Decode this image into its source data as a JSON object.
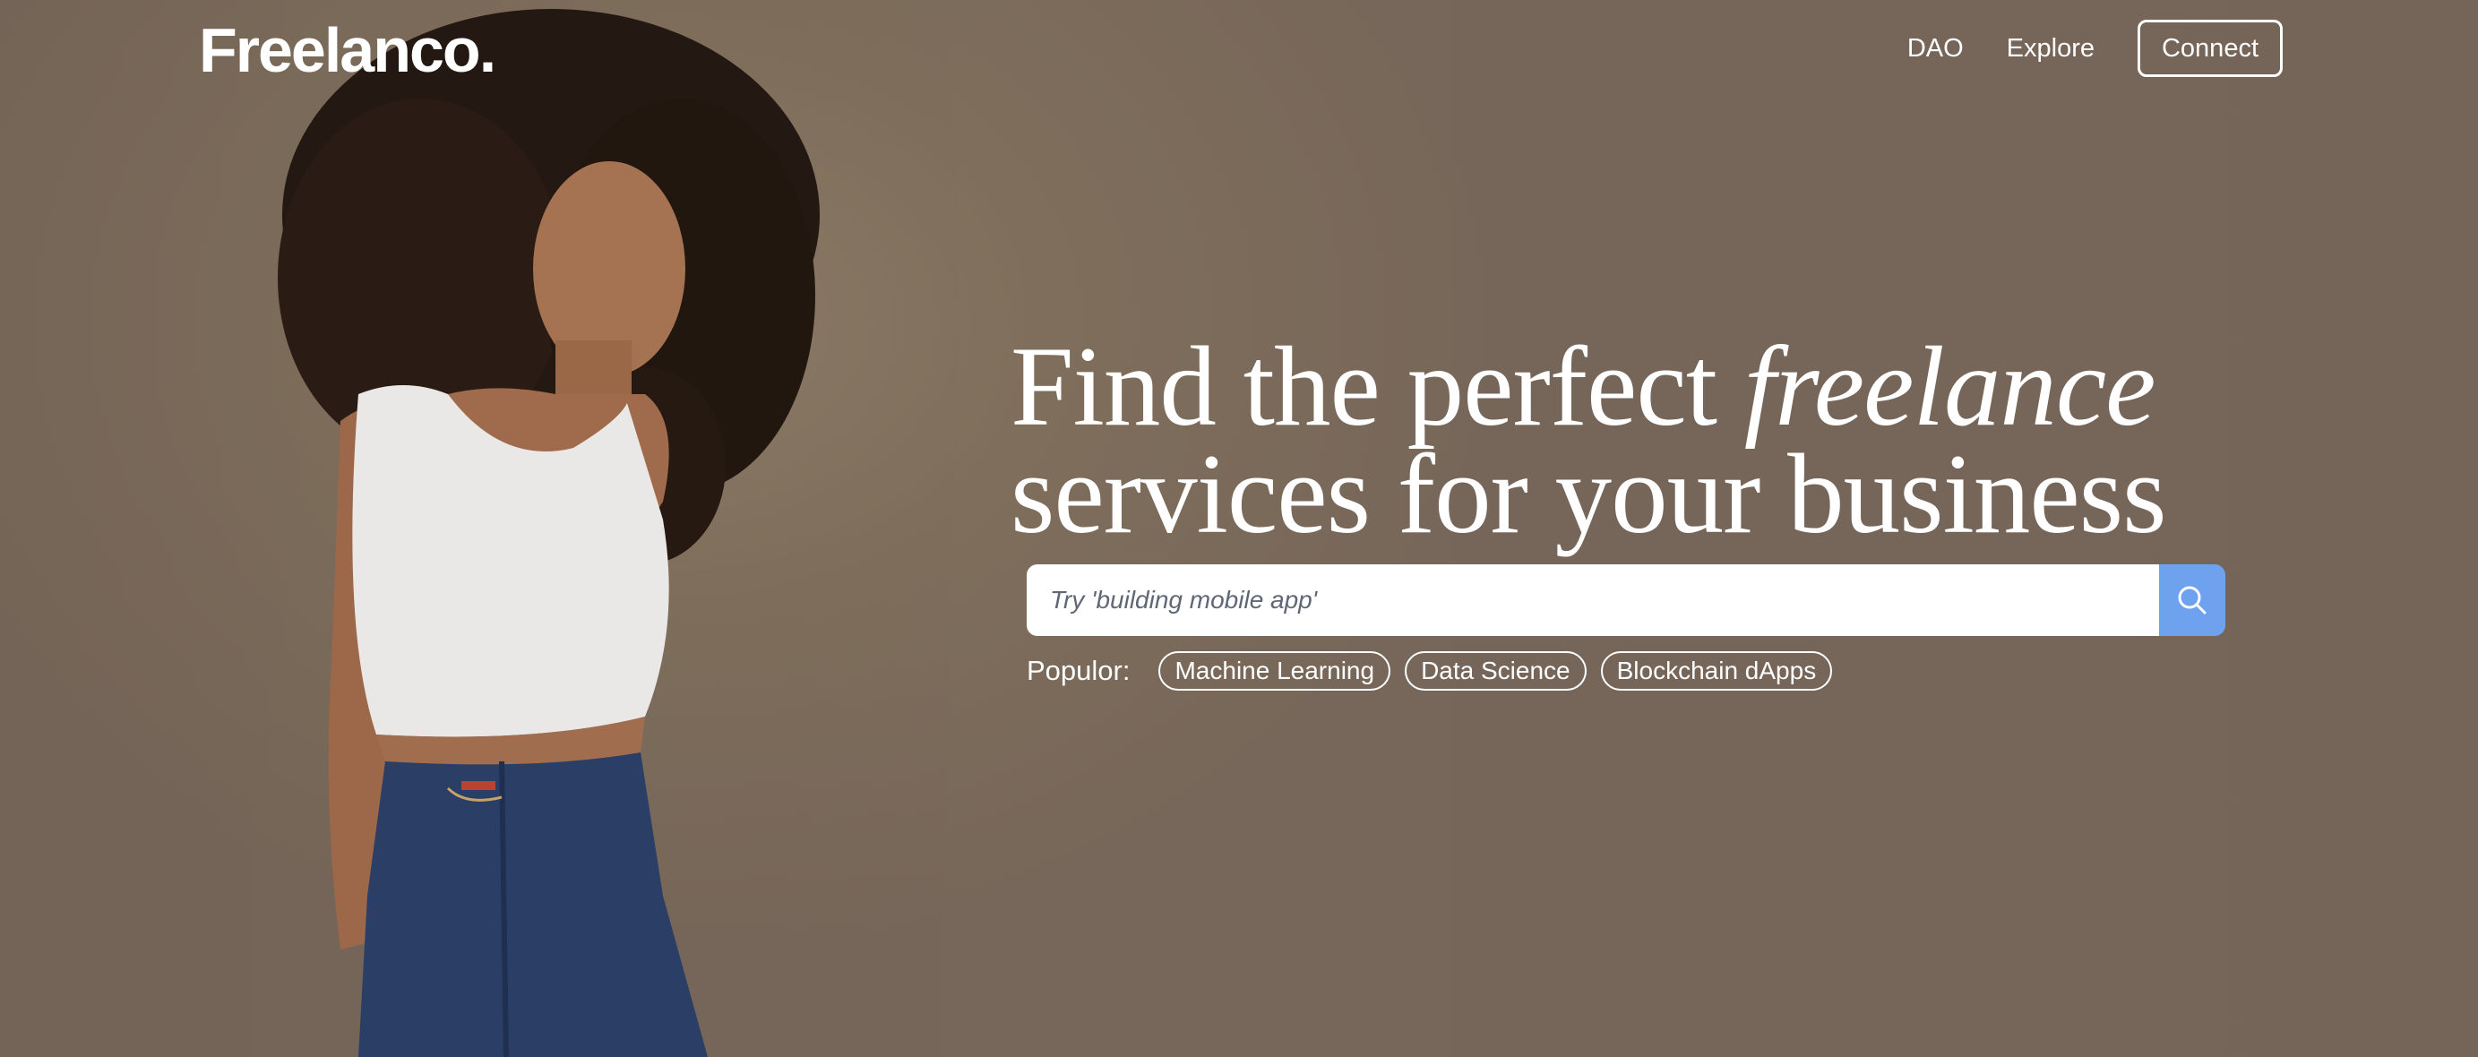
{
  "header": {
    "logo": "Freelanco.",
    "nav": [
      {
        "label": "DAO"
      },
      {
        "label": "Explore"
      }
    ],
    "connect_label": "Connect"
  },
  "hero": {
    "headline_part1": "Find the perfect ",
    "headline_italic": "freelance",
    "headline_line2": "services for your business",
    "search": {
      "placeholder": "Try 'building mobile app'",
      "value": "",
      "button_icon": "search-icon"
    },
    "popular": {
      "label": "Populor:",
      "tags": [
        "Machine Learning",
        "Data Science",
        "Blockchain dApps"
      ]
    }
  },
  "colors": {
    "background": "#7f6e5b",
    "search_button": "#6ea2ef",
    "text": "#ffffff"
  }
}
